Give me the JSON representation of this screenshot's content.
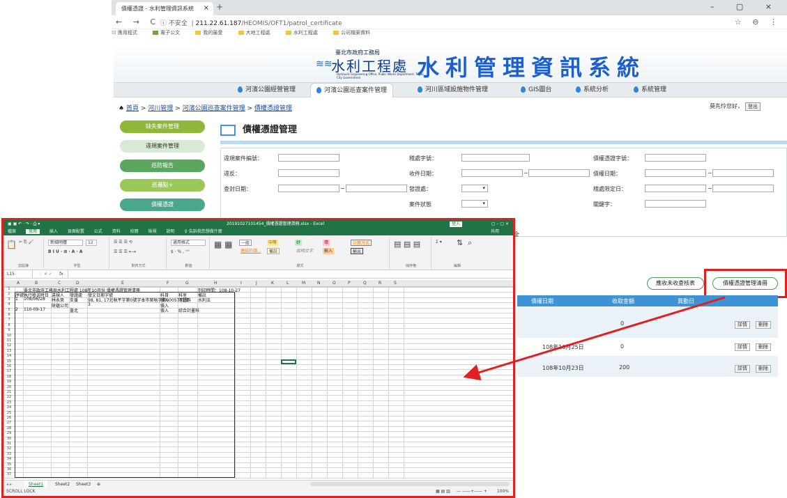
{
  "browser": {
    "tab_title": "債權憑證 - 水利管理資訊系統",
    "tab_close": "×",
    "new_tab": "+",
    "window_controls": "–  ▢  ×",
    "nav_icons": "← → C",
    "security": "ⓘ 不安全",
    "url_host": "211.22.61.187",
    "url_path": "/HEOMIS/OFT1/patrol_certificate",
    "right_icons": "☆ ⊖ ⋮",
    "bookmarks": [
      "應用程式",
      "電子公文",
      "我的最愛",
      "大地工程處",
      "水利工程處",
      "公司檔案資料"
    ]
  },
  "site": {
    "logo_org": "臺北市政府工務局",
    "logo_name": "水利工程處",
    "logo_en": "Hydraulic Engineering Office, Public Works Department, Taipei City Government",
    "system_title": "水利管理資訊系統",
    "nav": [
      "河濱公園經營管理",
      "河濱公園巡查案件管理",
      "河川區域設施物件管理",
      "GIS圖台",
      "系統分析",
      "系統管理"
    ],
    "breadcrumb_home": "首頁",
    "breadcrumb": [
      "河川管理",
      "河濱公園巡查案件管理",
      "債權憑證管理"
    ],
    "breadcrumb_sep": ">",
    "greeting": "莫先怜您好，",
    "logout": "登出"
  },
  "sidebar": [
    "缺失案件管理",
    "違規案件管理",
    "巡防報告",
    "巡邏點+",
    "債權憑證"
  ],
  "page": {
    "title": "債權憑證管理",
    "form_labels": {
      "case_no": "違規案件編號：",
      "doc_no": "稽處字號：",
      "cert_no": "債權憑證字號：",
      "violator": "違反：",
      "receive_date": "收件日期：",
      "debt_date": "債權日期：",
      "transfer_date": "查封日期：",
      "status": "發證處：",
      "doc_date": "稽處限定日：",
      "case_status": "案件狀態",
      "keyword": "關鍵字："
    },
    "range_sep": "~",
    "btn_unreceived": "應收未收查核表",
    "btn_list": "債權憑證管理清冊",
    "table_headers": [
      "債權日期",
      "收取金額",
      "異動日"
    ],
    "rows": [
      {
        "date": "",
        "amount": "0",
        "edit": "詳情",
        "delete": "刪除"
      },
      {
        "date": "108年10月25日",
        "amount": "0",
        "edit": "詳情",
        "delete": "刪除"
      },
      {
        "date": "108年10月23日",
        "amount": "200",
        "edit": "詳情",
        "delete": "刪除"
      }
    ],
    "partial_button": "全"
  },
  "excel": {
    "title": "20191027101454_債權憑證管理清冊.xlsx - Excel",
    "signin": "登入",
    "share": "共用",
    "tabs": [
      "檔案",
      "常用",
      "插入",
      "頁面配置",
      "公式",
      "資料",
      "校閱",
      "檢視",
      "說明",
      "♀ 告訴我您想做什麼"
    ],
    "ribbon_groups": [
      "剪貼簿",
      "字型",
      "對齊方式",
      "數值",
      "樣式",
      "儲存格",
      "編輯"
    ],
    "font_name": "新細明體",
    "font_size": "12",
    "number_format": "通用格式",
    "styles": [
      "一般",
      "中等",
      "好",
      "壞",
      "計算方式",
      "連結的儲...",
      "備註",
      "說明文字",
      "輸入",
      "輸出"
    ],
    "name_box": "L15",
    "fx": "fx",
    "columns": [
      "A",
      "B",
      "C",
      "D",
      "E",
      "F",
      "G",
      "H",
      "I",
      "J",
      "K",
      "L",
      "M",
      "N",
      "O",
      "P",
      "Q",
      "R",
      "S"
    ],
    "row1_title": "臺北市政府工務局水利工程處 108年10月份 債權憑證管理清冊",
    "row1_print": "列印時間：108-10-27",
    "header_row": [
      "序號",
      "執行移送時日",
      "違規人",
      "發證處",
      "發文日期字號",
      "科目",
      "科室",
      "備註"
    ],
    "data_rows": [
      [
        "1",
        "108/06/28",
        "林永來",
        "支援",
        "98, 81, 17北執平字第0號字本市案執字第0005791號",
        "債入",
        "河管科",
        "水利法"
      ],
      [
        "",
        "",
        "財蘊公司",
        "",
        "3",
        "債入",
        "",
        ""
      ],
      [
        "2",
        "110-09-17",
        "",
        "臺北",
        "",
        "債入",
        "綜合計畫科",
        ""
      ]
    ],
    "sheets": [
      "Sheet1",
      "Sheet2",
      "Sheet3",
      "⊕"
    ],
    "status_left": "SCROLL LOCK",
    "zoom": "100%"
  }
}
